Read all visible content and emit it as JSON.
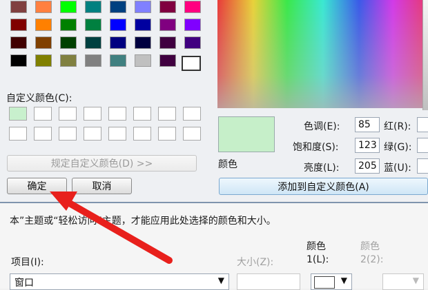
{
  "basic_colors": [
    [
      "#804040",
      "#ff8040",
      "#00ff00",
      "#008080",
      "#004080",
      "#8080ff",
      "#800040",
      "#ff0080"
    ],
    [
      "#800000",
      "#ff8000",
      "#008000",
      "#008040",
      "#0000ff",
      "#0000a0",
      "#800080",
      "#8000ff"
    ],
    [
      "#400000",
      "#804000",
      "#004000",
      "#004040",
      "#000080",
      "#000040",
      "#400040",
      "#400080"
    ],
    [
      "#000000",
      "#808000",
      "#808040",
      "#808080",
      "#408080",
      "#c0c0c0",
      "#400040",
      "#ffffff"
    ]
  ],
  "custom_colors_label": "自定义颜色(C):",
  "custom_colors": [
    [
      "#c8f0cd",
      "#ffffff",
      "#ffffff",
      "#ffffff",
      "#ffffff",
      "#ffffff",
      "#ffffff",
      "#ffffff"
    ],
    [
      "#ffffff",
      "#ffffff",
      "#ffffff",
      "#ffffff",
      "#ffffff",
      "#ffffff",
      "#ffffff",
      "#ffffff"
    ]
  ],
  "define_custom_label": "规定自定义颜色(D) >>",
  "ok_label": "确定",
  "cancel_label": "取消",
  "preview_color": "#c6efc9",
  "color_solid_label": "颜色",
  "hue_label": "色调(E):",
  "hue_value": "85",
  "sat_label": "饱和度(S):",
  "sat_value": "123",
  "lum_label": "亮度(L):",
  "lum_value": "205",
  "red_label": "红(R):",
  "green_label": "绿(G):",
  "blue_label": "蓝(U):",
  "add_custom_label": "添加到自定义颜色(A)",
  "lower": {
    "notice": "本”主题或“轻松访问”主题，才能应用此处选择的颜色和大小。",
    "item_label": "项目(I):",
    "item_value": "窗口",
    "size_label": "大小(Z):",
    "color1_label": "颜色",
    "color1_sub": "1(L):",
    "color2_label": "颜色",
    "color2_sub": "2(2):"
  },
  "annotation_arrow_color": "#e8201c"
}
